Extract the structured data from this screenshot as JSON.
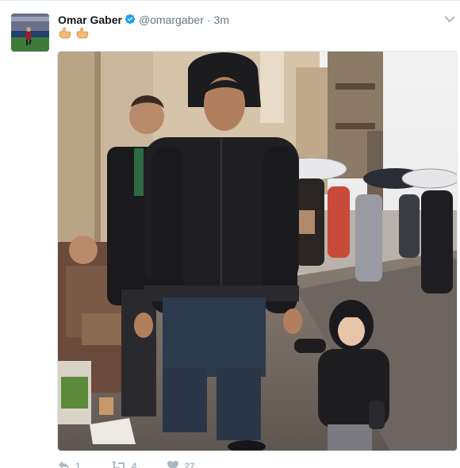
{
  "tweet": {
    "display_name": "Omar Gaber",
    "handle": "@omargaber",
    "separator": "·",
    "timestamp": "3m",
    "text_emojis": [
      "hand-emoji",
      "hand-emoji"
    ],
    "photo_icon": "photo",
    "verified_icon": "verified-badge-icon",
    "caret_icon": "chevron-down-icon"
  },
  "actions": {
    "reply": {
      "icon": "reply-icon",
      "count": "1"
    },
    "retweet": {
      "icon": "retweet-icon",
      "count": "4"
    },
    "like": {
      "icon": "heart-icon",
      "count": "27"
    }
  },
  "colors": {
    "name": "#14171a",
    "secondary": "#657786",
    "verified": "#1da1f2",
    "action": "#aab8c2"
  }
}
